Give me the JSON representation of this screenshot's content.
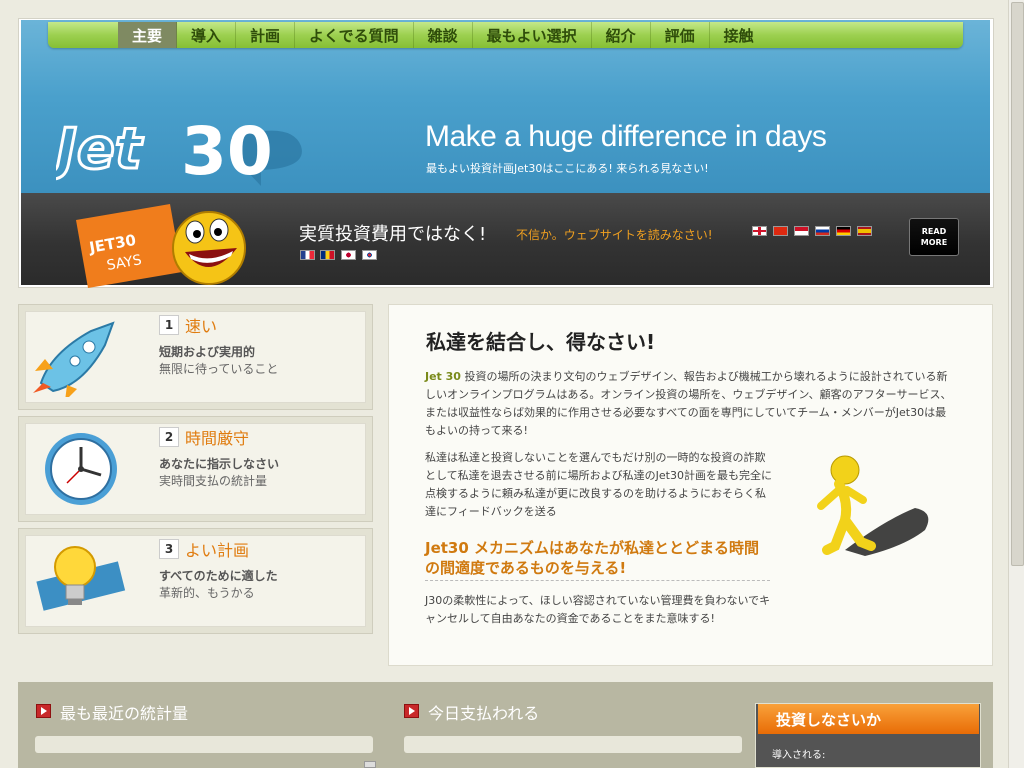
{
  "nav": {
    "items": [
      "主要",
      "導入",
      "計画",
      "よくでる質問",
      "雑談",
      "最もよい選択",
      "紹介",
      "評価",
      "接触"
    ],
    "active_index": 0
  },
  "banner": {
    "logo_text": "Jet 30",
    "headline": "Make a huge difference in days",
    "subline": "最もよい投資計画Jet30はここにある! 来られる見なさい!"
  },
  "says": {
    "badge_line1": "JET30",
    "badge_line2": "SAYS",
    "slogan": "実質投資費用ではなく!",
    "link": "不信か。ウェブサイトを読みなさい!",
    "read_more_line1": "READ",
    "read_more_line2": "MORE"
  },
  "features": [
    {
      "num": "1",
      "title": "速い",
      "line1": "短期および実用的",
      "line2": "無限に待っていること",
      "icon": "rocket-icon"
    },
    {
      "num": "2",
      "title": "時間厳守",
      "line1": "あなたに指示しなさい",
      "line2": "実時間支払の統計量",
      "icon": "clock-icon"
    },
    {
      "num": "3",
      "title": "よい計画",
      "line1": "すべてのために適した",
      "line2": "革新的、もうかる",
      "icon": "lightbulb-icon"
    }
  ],
  "content": {
    "title": "私達を結合し、得なさい!",
    "p1_brand": "Jet 30",
    "p1_text": " 投資の場所の決まり文句のウェブデザイン、報告および機械工から壊れるように設計されている新しいオンラインプログラムはある。オンライン投資の場所を、ウェブデザイン、顧客のアフターサービス、または収益性ならば効果的に作用させる必要なすべての面を専門にしていてチーム・メンバーがJet30は最もよいの持って来る!",
    "p2": "私達は私達と投資しないことを選んでもだけ別の一時的な投資の詐欺として私達を退去させる前に場所および私達のJet30計画を最も完全に点検するように頼み私達が更に改良するのを助けるようにおそらく私達にフィードバックを送る",
    "subtitle": "Jet30 メカニズムはあなたが私達ととどまる時間の間適度であるものを与える!",
    "p3": "J30の柔軟性によって、ほしい容認されていない管理費を負わないでキャンセルして自由あなたの資金であることをまた意味する!"
  },
  "bottom": {
    "recent_stats": "最も最近の統計量",
    "paid_today": "今日支払われる",
    "invest_title": "投資しなさいか",
    "invest_label": "導入される:"
  }
}
